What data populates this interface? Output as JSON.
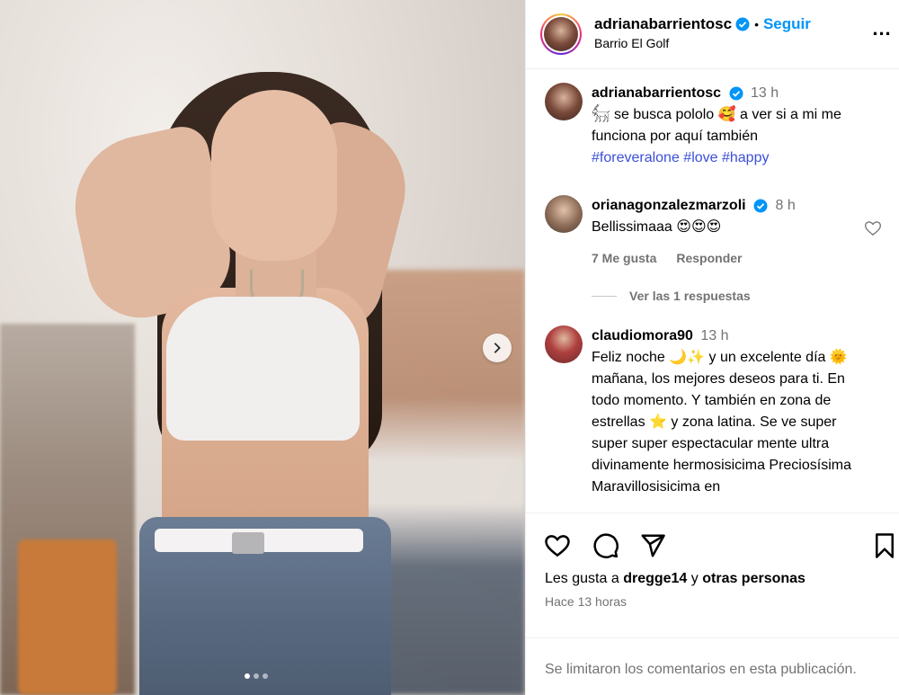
{
  "post": {
    "author": "adrianabarrientosc",
    "follow_label": "Seguir",
    "location": "Barrio El Golf",
    "more_label": "...",
    "carousel": {
      "current_index": 1,
      "count": 3
    }
  },
  "comments": [
    {
      "user": "adrianabarrientosc",
      "verified": true,
      "time": "13 h",
      "text": "𓃶 se busca pololo 🥰 a ver si a mi me funciona por aquí también",
      "hashtags": "#foreveralone #love #happy"
    },
    {
      "user": "orianagonzalezmarzoli",
      "verified": true,
      "time": "8 h",
      "text": "Bellissimaaa 😍😍😍",
      "likes": "7 Me gusta",
      "reply_label": "Responder",
      "replies_label": "Ver las 1 respuestas"
    },
    {
      "user": "claudiomora90",
      "verified": false,
      "time": "13 h",
      "text": "Feliz noche 🌙✨ y un excelente día 🌞 mañana, los mejores deseos para ti. En todo momento. Y también en zona de estrellas ⭐ y zona latina. Se ve super super super espectacular mente ultra divinamente hermosisicima Preciosísima Maravillosisicima en"
    }
  ],
  "actions": {
    "likes_prefix": "Les gusta a",
    "likes_user": "dregge14",
    "likes_conj": "y",
    "likes_suffix": "otras personas",
    "time_ago": "Hace 13 horas"
  },
  "footer": {
    "limited_text": "Se limitaron los comentarios en esta publicación."
  },
  "colors": {
    "accent": "#0095f6",
    "hashtag": "#3b4fd9",
    "secondary_text": "#737373"
  }
}
